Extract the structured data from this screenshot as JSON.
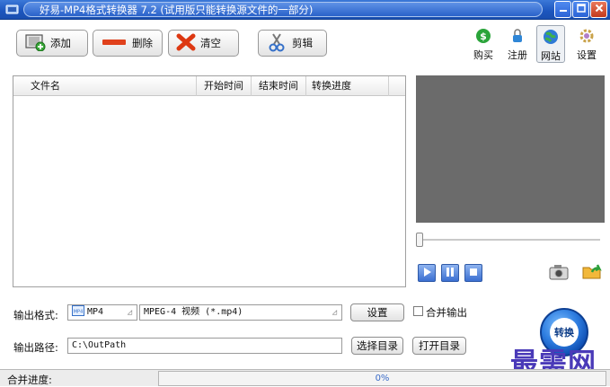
{
  "window": {
    "title": "好易-MP4格式转换器 7.2 (试用版只能转换源文件的一部分)"
  },
  "toolbar": {
    "add_label": "添加",
    "delete_label": "删除",
    "clear_label": "清空",
    "cut_label": "剪辑",
    "buy_label": "购买",
    "register_label": "注册",
    "website_label": "网站",
    "settings_label": "设置"
  },
  "filelist": {
    "columns": [
      "文件名",
      "开始时间",
      "结束时间",
      "转换进度"
    ],
    "rows": []
  },
  "player": {
    "seek_position": 0
  },
  "output": {
    "format_label": "输出格式:",
    "format_value": "MP4",
    "format_badge": "MP4",
    "profile_value": "MPEG-4 视频 (*.mp4)",
    "settings_button": "设置",
    "merge_label": "合并输出",
    "merge_checked": false,
    "path_label": "输出路径:",
    "path_value": "C:\\OutPath",
    "choose_dir_button": "选择目录",
    "open_dir_button": "打开目录",
    "convert_button": "转换"
  },
  "status": {
    "merge_progress_label": "合并进度:",
    "progress_percent": 0,
    "progress_text": "0%"
  },
  "watermark": "最需网",
  "colors": {
    "titlebar": "#1c55bd",
    "preview": "#6b6b6b",
    "watermark": "#4a3ab8"
  }
}
